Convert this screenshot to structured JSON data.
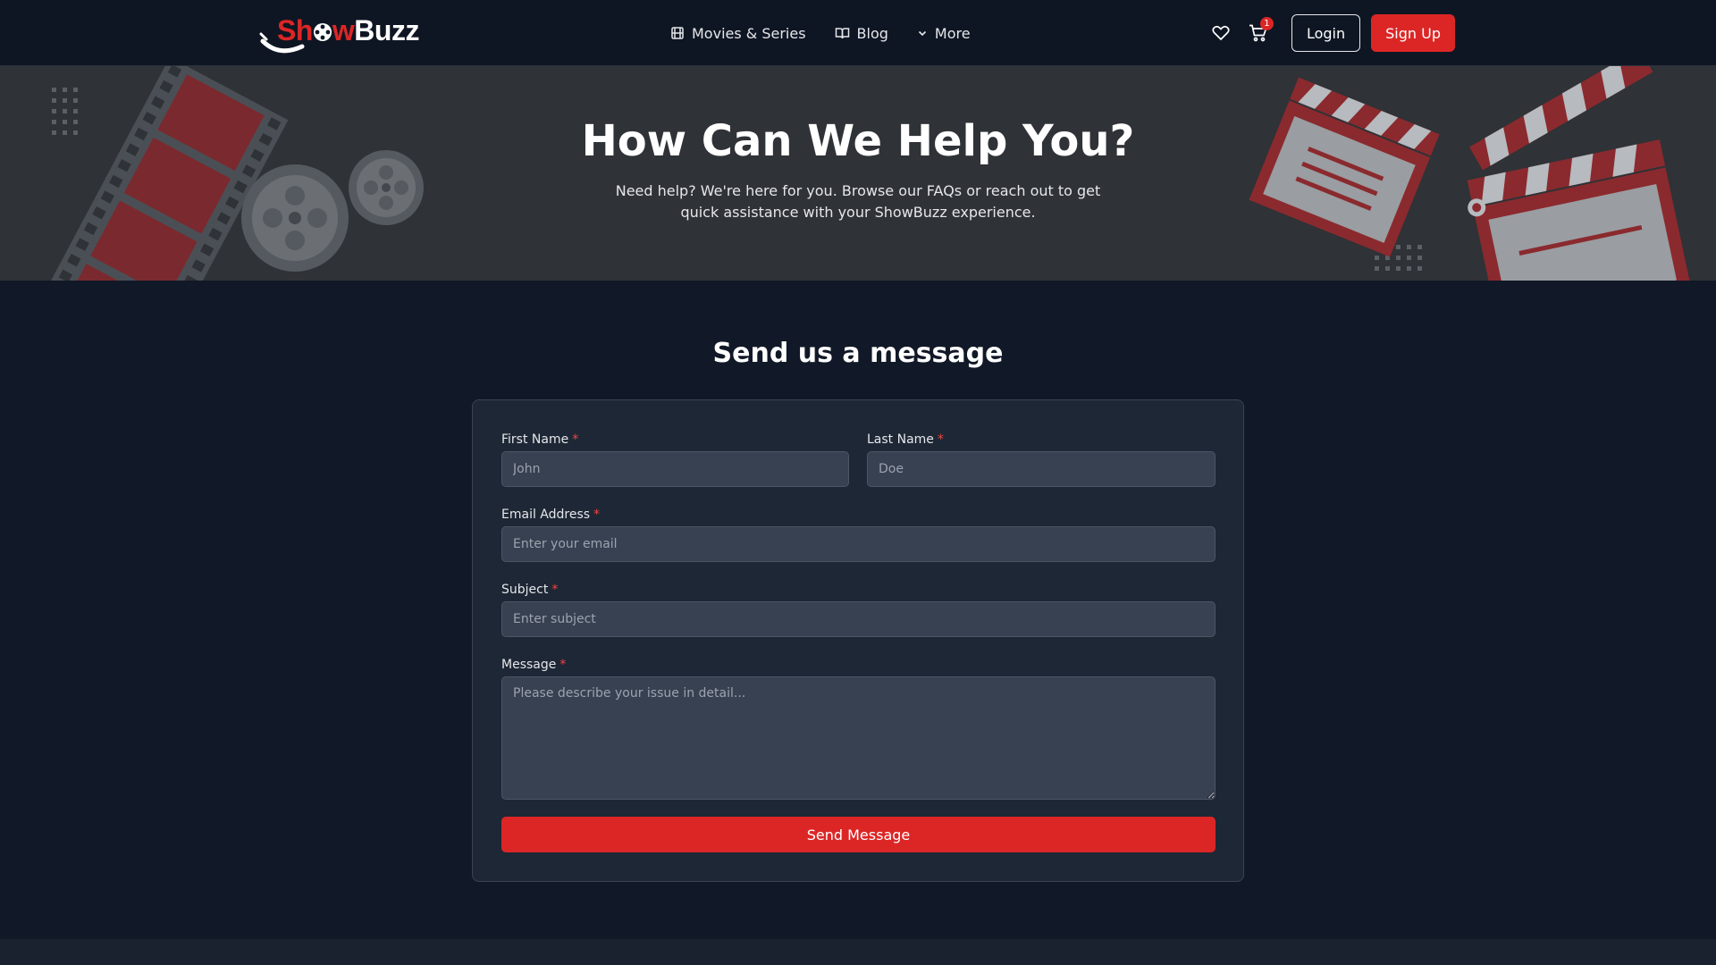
{
  "brand": {
    "logo_part1": "Sh",
    "logo_part2": "w",
    "logo_part3": "Buzz",
    "accent_color": "#dc2626"
  },
  "nav": {
    "links": [
      {
        "label": "Movies & Series",
        "icon": "film-icon"
      },
      {
        "label": "Blog",
        "icon": "book-open-icon"
      },
      {
        "label": "More",
        "icon": "chevron-down-icon"
      }
    ],
    "cart_count": "1",
    "login_label": "Login",
    "signup_label": "Sign Up"
  },
  "hero": {
    "title": "How Can We Help You?",
    "subtitle": "Need help? We're here for you. Browse our FAQs or reach out to get quick assistance with your ShowBuzz experience."
  },
  "form": {
    "section_title": "Send us a message",
    "required_mark": "*",
    "first_name": {
      "label": "First Name",
      "placeholder": "John"
    },
    "last_name": {
      "label": "Last Name",
      "placeholder": "Doe"
    },
    "email": {
      "label": "Email Address",
      "placeholder": "Enter your email"
    },
    "subject": {
      "label": "Subject",
      "placeholder": "Enter subject"
    },
    "message": {
      "label": "Message",
      "placeholder": "Please describe your issue in detail..."
    },
    "submit_label": "Send Message"
  }
}
